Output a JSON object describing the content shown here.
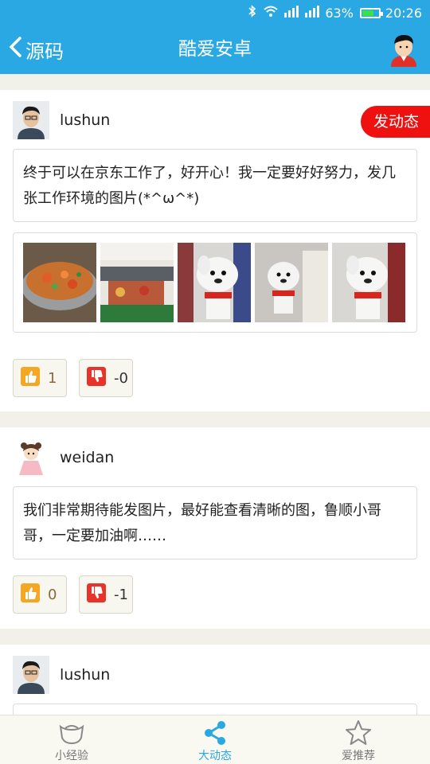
{
  "status_bar": {
    "battery": "63%",
    "time": "20:26",
    "battery_level": 0.63
  },
  "app_bar": {
    "back_label": "源码",
    "title": "酷爱安卓"
  },
  "compose_label": "发动态",
  "posts": [
    {
      "username": "lushun",
      "text": "终于可以在京东工作了，好开心！我一定要好好努力，发几张工作环境的图片(*^ω^*)",
      "likes": "1",
      "dislikes": "-0"
    },
    {
      "username": "weidan",
      "text": "我们非常期待能发图片，最好能查看清晰的图，鲁顺小哥哥，一定要加油啊……",
      "likes": "0",
      "dislikes": "-1"
    },
    {
      "username": "lushun"
    }
  ],
  "bottom_nav": [
    {
      "label": "小经验",
      "icon": "ingot-icon"
    },
    {
      "label": "大动态",
      "icon": "share-icon"
    },
    {
      "label": "爱推荐",
      "icon": "star-icon"
    }
  ],
  "colors": {
    "primary": "#29a8e3",
    "compose": "#ef1010",
    "background": "#f2f1e9"
  }
}
